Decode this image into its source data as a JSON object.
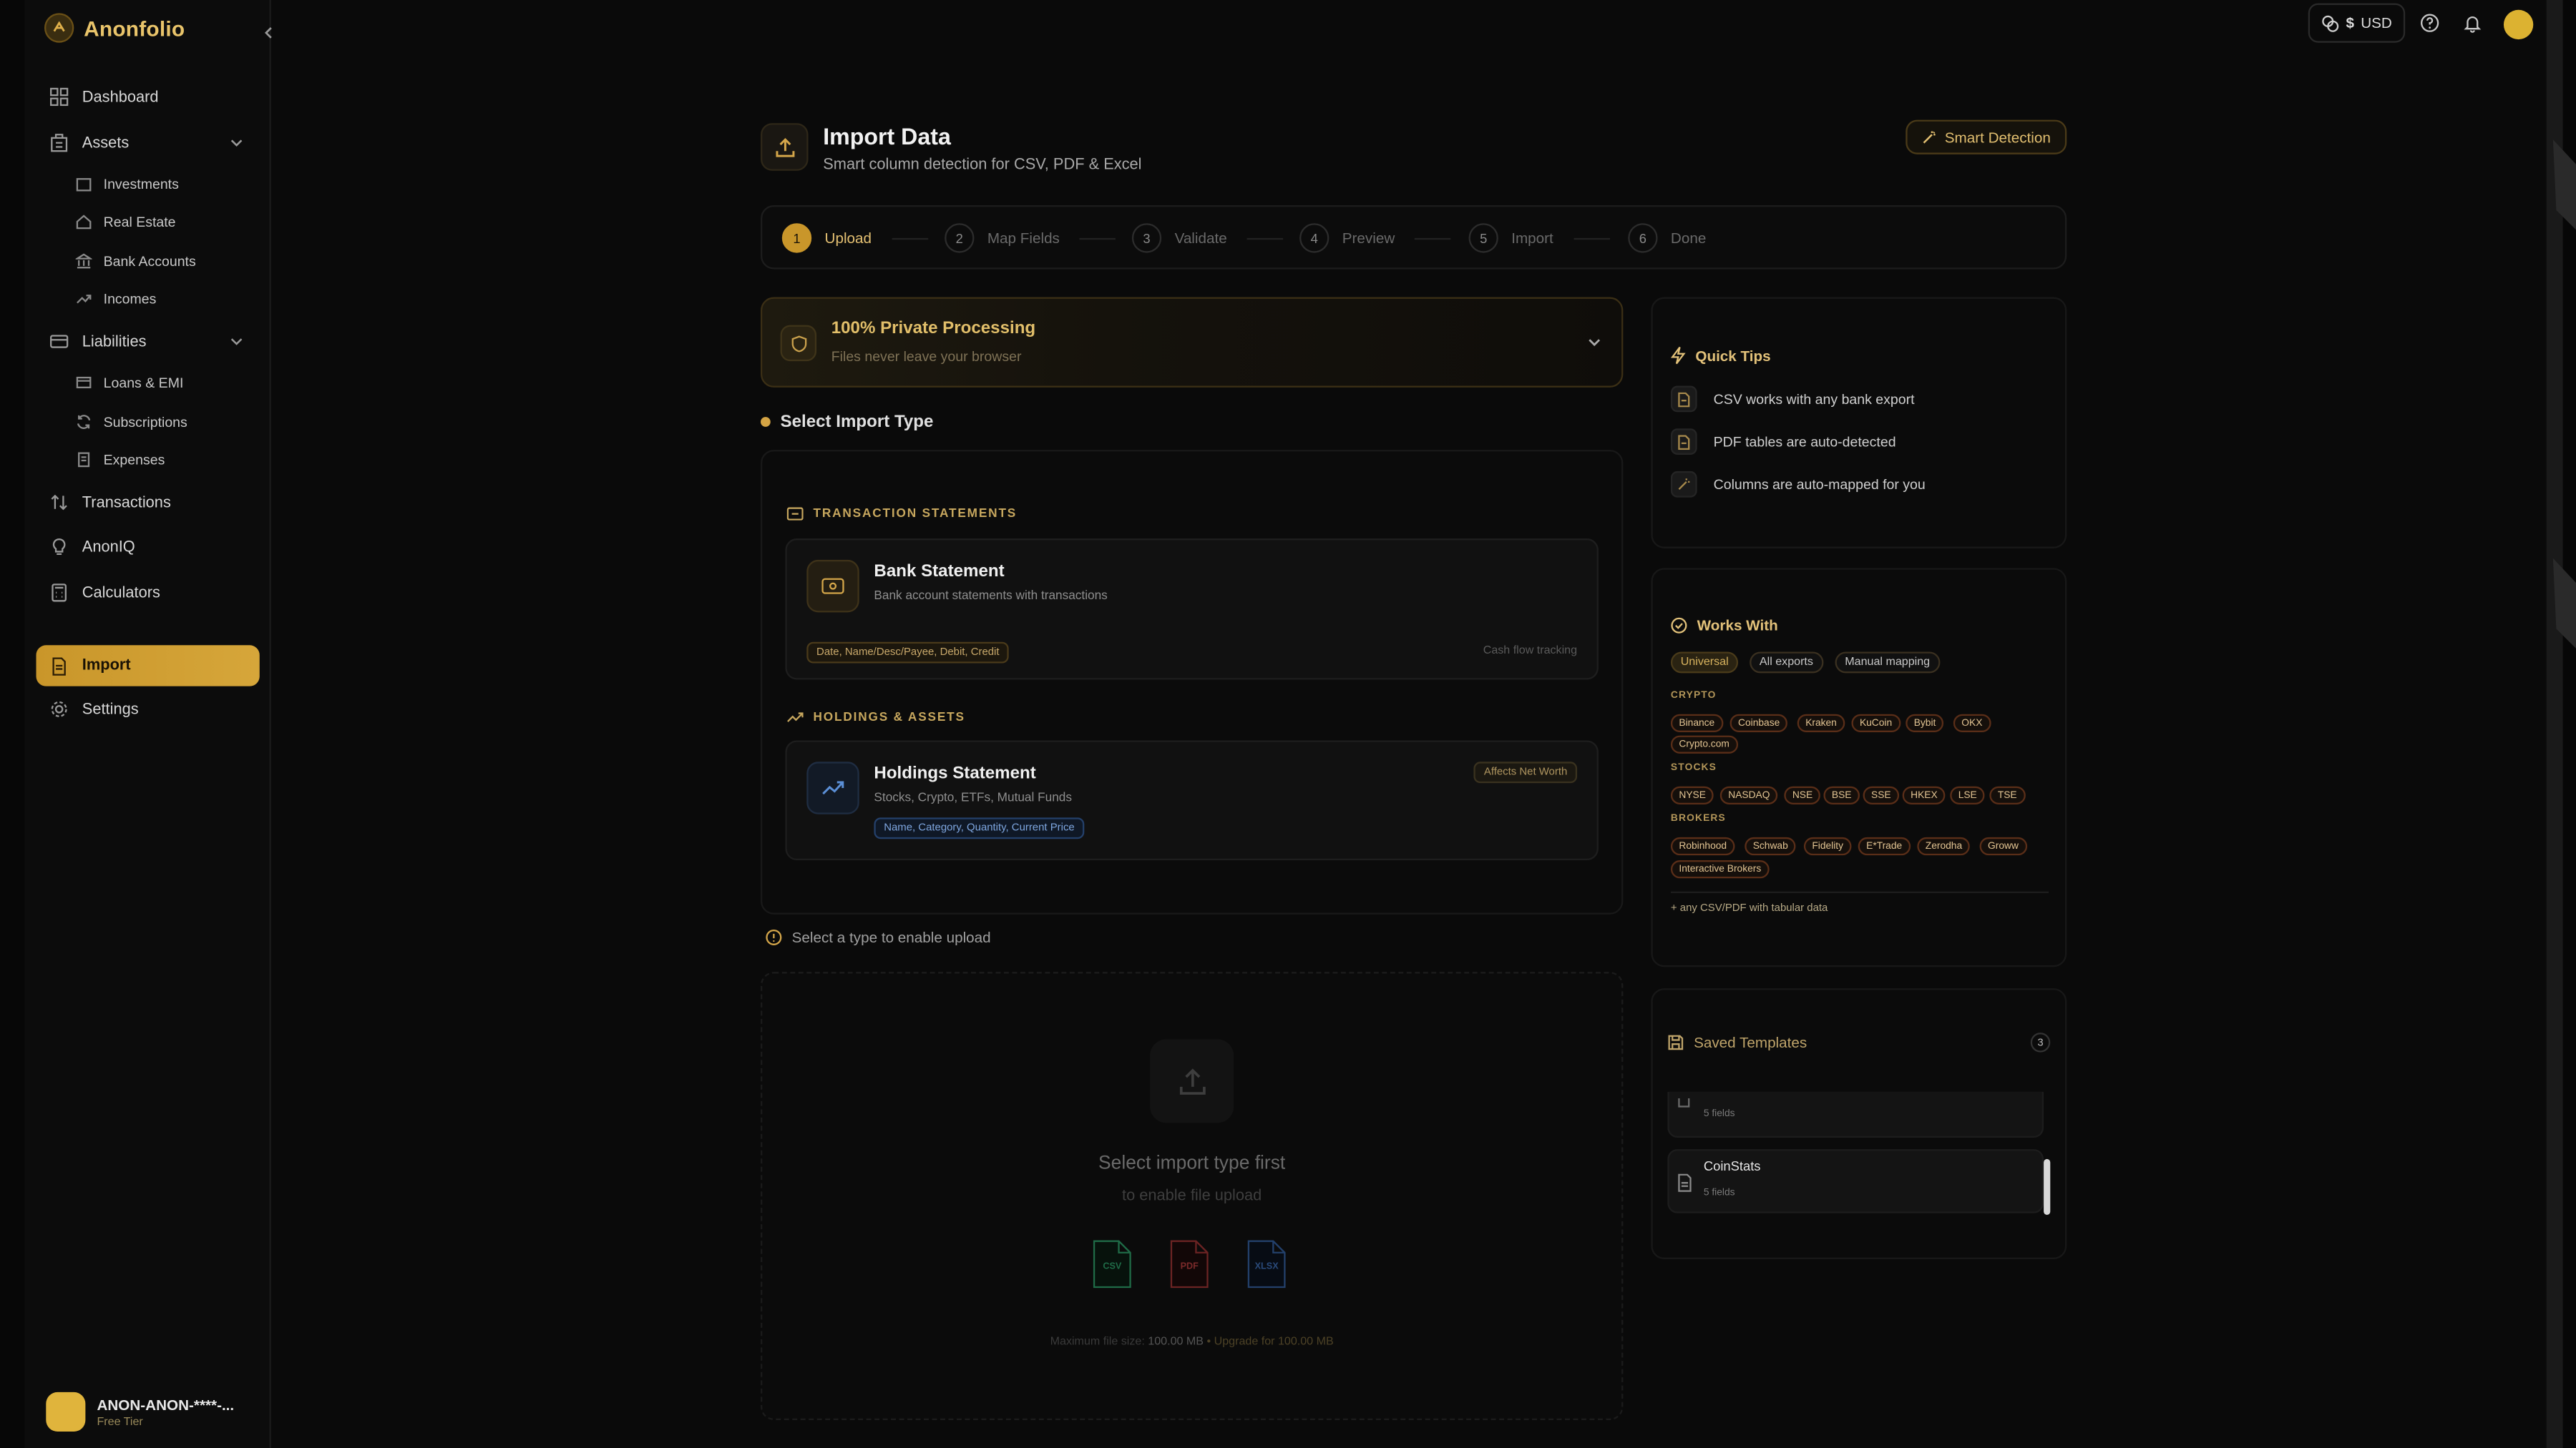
{
  "app": {
    "name": "Anonfolio"
  },
  "sidebar": {
    "items": [
      {
        "label": "Dashboard"
      },
      {
        "label": "Assets"
      },
      {
        "label": "Liabilities"
      },
      {
        "label": "Transactions"
      },
      {
        "label": "AnonIQ"
      },
      {
        "label": "Calculators"
      },
      {
        "label": "Import"
      },
      {
        "label": "Settings"
      }
    ],
    "assets_sub": [
      {
        "label": "Investments"
      },
      {
        "label": "Real Estate"
      },
      {
        "label": "Bank Accounts"
      },
      {
        "label": "Incomes"
      }
    ],
    "liabilities_sub": [
      {
        "label": "Loans & EMI"
      },
      {
        "label": "Subscriptions"
      },
      {
        "label": "Expenses"
      }
    ],
    "user": {
      "name": "ANON-ANON-****-...",
      "tier": "Free Tier"
    }
  },
  "topbar": {
    "currency_symbol": "$",
    "currency": "USD"
  },
  "page": {
    "title": "Import Data",
    "subtitle": "Smart column detection for CSV, PDF & Excel",
    "smart_detection": "Smart Detection"
  },
  "steps": [
    {
      "num": "1",
      "label": "Upload"
    },
    {
      "num": "2",
      "label": "Map Fields"
    },
    {
      "num": "3",
      "label": "Validate"
    },
    {
      "num": "4",
      "label": "Preview"
    },
    {
      "num": "5",
      "label": "Import"
    },
    {
      "num": "6",
      "label": "Done"
    }
  ],
  "privacy": {
    "title": "100% Private Processing",
    "subtitle": "Files never leave your browser"
  },
  "import_type": {
    "heading": "Select Import Type",
    "transactions_heading": "TRANSACTION STATEMENTS",
    "bank": {
      "title": "Bank Statement",
      "desc": "Bank account statements with transactions",
      "fields": "Date, Name/Desc/Payee, Debit, Credit",
      "note": "Cash flow tracking"
    },
    "holdings_heading": "HOLDINGS & ASSETS",
    "holdings": {
      "title": "Holdings Statement",
      "desc": "Stocks, Crypto, ETFs, Mutual Funds",
      "fields": "Name, Category, Quantity, Current Price",
      "badge": "Affects Net Worth"
    }
  },
  "upload": {
    "hint": "Select a type to enable upload",
    "title": "Select import type first",
    "subtitle": "to enable file upload",
    "file_types": [
      "CSV",
      "PDF",
      "XLSX"
    ],
    "max_label": "Maximum file size:",
    "max_value": "100.00 MB",
    "upgrade": "• Upgrade for 100.00 MB"
  },
  "tips": {
    "title": "Quick Tips",
    "items": [
      {
        "text": "CSV works with any bank export",
        "icon": "file-icon"
      },
      {
        "text": "PDF tables are auto-detected",
        "icon": "file-icon"
      },
      {
        "text": "Columns are auto-mapped for you",
        "icon": "wand-icon"
      }
    ]
  },
  "works_with": {
    "title": "Works With",
    "chips": [
      "Universal",
      "All exports",
      "Manual mapping"
    ],
    "crypto_label": "CRYPTO",
    "crypto": [
      "Binance",
      "Coinbase",
      "Kraken",
      "KuCoin",
      "Bybit",
      "OKX",
      "Crypto.com"
    ],
    "stocks_label": "STOCKS",
    "stocks": [
      "NYSE",
      "NASDAQ",
      "NSE",
      "BSE",
      "SSE",
      "HKEX",
      "LSE",
      "TSE"
    ],
    "brokers_label": "BROKERS",
    "brokers": [
      "Robinhood",
      "Schwab",
      "Fidelity",
      "E*Trade",
      "Zerodha",
      "Groww",
      "Interactive Brokers"
    ],
    "footer": "+ any CSV/PDF with tabular data"
  },
  "templates": {
    "title": "Saved Templates",
    "count": "3",
    "items": [
      {
        "name": "",
        "fields": "5 fields"
      },
      {
        "name": "CoinStats",
        "fields": "5 fields"
      }
    ]
  },
  "colors": {
    "accent": "#c9962a",
    "accent_text": "#e2bf6a",
    "background": "#0a0a0a"
  }
}
